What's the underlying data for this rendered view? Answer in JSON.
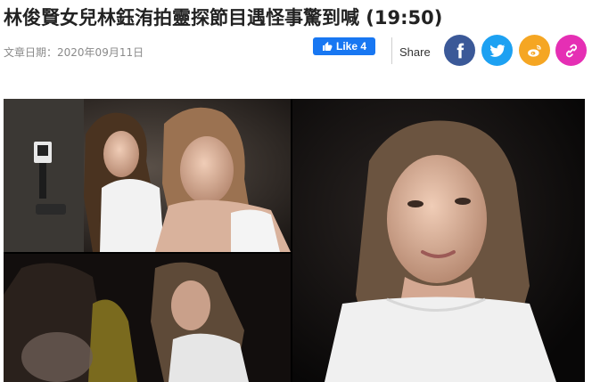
{
  "article": {
    "title": "林俊賢女兒林鈺洧拍靈探節目遇怪事驚到喊 (19:50)",
    "date_label": "文章日期：",
    "date_value": "2020年09月11日"
  },
  "social": {
    "like_label": "Like 4",
    "share_label": "Share",
    "icons": [
      "facebook-icon",
      "twitter-icon",
      "weibo-icon",
      "link-icon"
    ],
    "colors": {
      "facebook": "#3b5998",
      "twitter": "#1da1f2",
      "weibo": "#f5a623",
      "link": "#e52fb4",
      "like": "#1877f2"
    }
  }
}
